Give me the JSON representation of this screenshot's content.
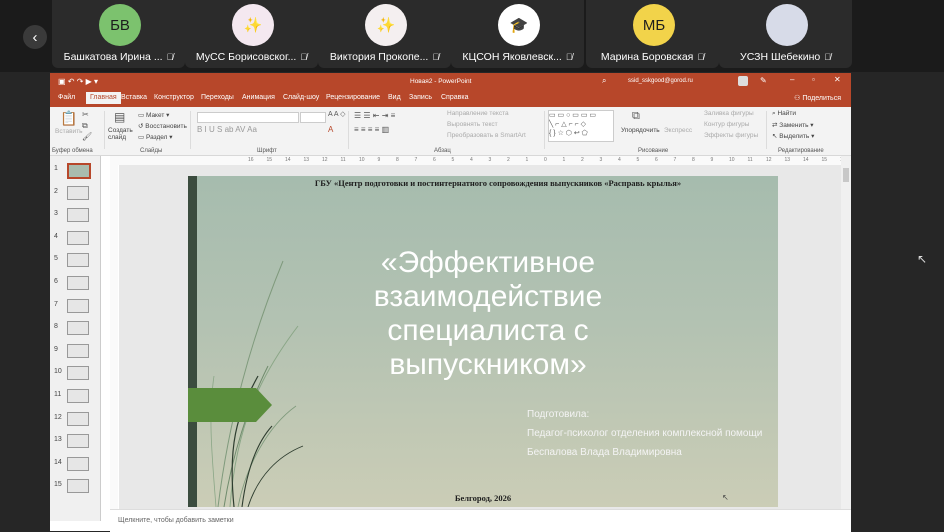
{
  "participants": [
    {
      "name": "Башкатова Ирина ...",
      "initials": "БВ",
      "avatar_bg": "#7cc26e",
      "avatar_fg": "#1e1e1e"
    },
    {
      "name": "МуСС Борисовског...",
      "initials": "✨",
      "avatar_bg": "#f4e8f0",
      "avatar_fg": "#e2b23a"
    },
    {
      "name": "Виктория Прокопе...",
      "initials": "✨",
      "avatar_bg": "#f4eff0",
      "avatar_fg": "#e2b23a"
    },
    {
      "name": "КЦСОН Яковлевск...",
      "initials": "🎓",
      "avatar_bg": "#ffffff",
      "avatar_fg": "#1e1e1e"
    },
    {
      "name": "Марина Боровская",
      "initials": "МБ",
      "avatar_bg": "#f2d34a",
      "avatar_fg": "#1e1e1e"
    },
    {
      "name": "УСЗН Шебекино",
      "initials": "",
      "avatar_bg": "#d7dbe8",
      "avatar_fg": "#c0392b"
    }
  ],
  "colors": {
    "accent": "#b7472a",
    "slide_bar": "#3b4c3e",
    "slide_arrow": "#5a8d3c"
  },
  "ppt": {
    "window_title": "Новая2 - PowerPoint",
    "account": "ssid_sskgood@gorod.ru",
    "share": "Поделиться",
    "tabs": [
      "Файл",
      "Главная",
      "Вставка",
      "Конструктор",
      "Переходы",
      "Анимация",
      "Слайд-шоу",
      "Рецензирование",
      "Вид",
      "Запись",
      "Справка"
    ],
    "active_tab": "Главная",
    "ribbon": {
      "clipboard_label": "Буфер обмена",
      "paste": "Вставить",
      "new_slide": "Создать слайд",
      "layout": "Макет",
      "reset": "Восстановить",
      "section": "Раздел",
      "slides_label": "Слайды",
      "font_label": "Шрифт",
      "paragraph_label": "Абзац",
      "text_direction": "Направление текста",
      "align_text": "Выровнять текст",
      "smartart": "Преобразовать в SmartArt",
      "arrange": "Упорядочить",
      "quick_styles": "Экспресс-стили",
      "shape_fill": "Заливка фигуры",
      "shape_outline": "Контур фигуры",
      "shape_effects": "Эффекты фигуры",
      "drawing_label": "Рисование",
      "find": "Найти",
      "replace": "Заменить",
      "select": "Выделить",
      "editing_label": "Редактирование"
    },
    "slide_numbers": [
      "1",
      "2",
      "3",
      "4",
      "5",
      "6",
      "7",
      "8",
      "9",
      "10",
      "11",
      "12",
      "13",
      "14",
      "15"
    ],
    "selected_slide": "1",
    "ruler_ticks": [
      "16",
      "15",
      "14",
      "13",
      "12",
      "11",
      "10",
      "9",
      "8",
      "7",
      "6",
      "5",
      "4",
      "3",
      "2",
      "1",
      "0",
      "1",
      "2",
      "3",
      "4",
      "5",
      "6",
      "7",
      "8",
      "9",
      "10",
      "11",
      "12",
      "13",
      "14",
      "15",
      "16"
    ],
    "notes_placeholder": "Щелкните, чтобы добавить заметки"
  },
  "slide": {
    "header": "ГБУ «Центр подготовки и постинтернатного сопровождения выпускников «Расправь крылья»",
    "title": "«Эффективное\nвзаимодействие\nспециалиста с\nвыпускником»",
    "author_lines": [
      "Подготовила:",
      "Педагог-психолог отделения комплексной помощи",
      "Беспалова Влада Владимировна"
    ],
    "footer": "Белгород, 2026"
  }
}
